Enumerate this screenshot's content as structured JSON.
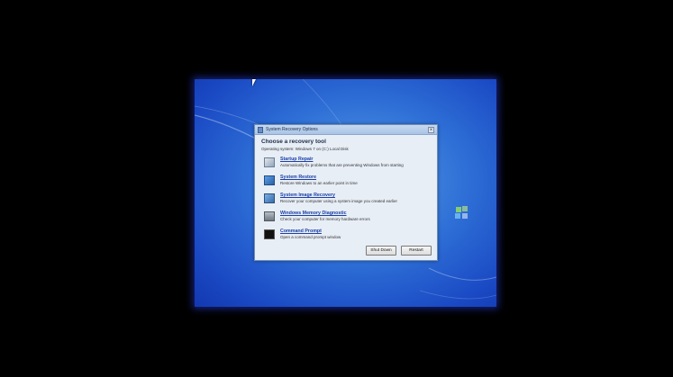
{
  "dialog": {
    "title": "System Recovery Options",
    "close_glyph": "×",
    "heading": "Choose a recovery tool",
    "os_line": "Operating system: Windows 7 on (C:) Local Disk",
    "tools": [
      {
        "label": "Startup Repair",
        "description": "Automatically fix problems that are preventing Windows from starting",
        "icon": "startup-repair-icon"
      },
      {
        "label": "System Restore",
        "description": "Restore Windows to an earlier point in time",
        "icon": "system-restore-icon"
      },
      {
        "label": "System Image Recovery",
        "description": "Recover your computer using a system image you created earlier",
        "icon": "system-image-icon"
      },
      {
        "label": "Windows Memory Diagnostic",
        "description": "Check your computer for memory hardware errors",
        "icon": "memory-diagnostic-icon"
      },
      {
        "label": "Command Prompt",
        "description": "Open a command prompt window",
        "icon": "command-prompt-icon"
      }
    ],
    "shutdown_label": "Shut Down",
    "restart_label": "Restart"
  }
}
